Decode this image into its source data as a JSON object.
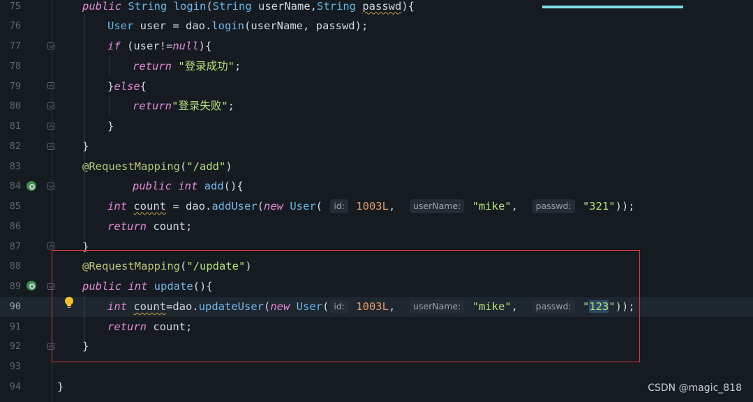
{
  "colors": {
    "background": "#161b22",
    "keyword": "#e38bd8",
    "annotation": "#b6c77a",
    "string": "#b6e07c",
    "type": "#65b8e6",
    "number": "#e79c6a",
    "redbox": "#d33b3b"
  },
  "editor": {
    "current_line": 90,
    "lines": [
      {
        "n": "75",
        "tokens": [
          {
            "t": "public ",
            "c": "kw"
          },
          {
            "t": "String ",
            "c": "type"
          },
          {
            "t": "login",
            "c": "method"
          },
          {
            "t": "(",
            "c": "plain"
          },
          {
            "t": "String ",
            "c": "type"
          },
          {
            "t": "userName",
            "c": "plain"
          },
          {
            "t": ",",
            "c": "plain"
          },
          {
            "t": "String ",
            "c": "type"
          },
          {
            "t": "passwd",
            "c": "plain",
            "u": true
          },
          {
            "t": "){",
            "c": "plain"
          }
        ]
      },
      {
        "n": "76",
        "tokens": [
          {
            "t": "User ",
            "c": "type"
          },
          {
            "t": "user = dao.",
            "c": "plain"
          },
          {
            "t": "login",
            "c": "method"
          },
          {
            "t": "(userName, passwd);",
            "c": "plain"
          }
        ]
      },
      {
        "n": "77",
        "tokens": [
          {
            "t": "if ",
            "c": "kw"
          },
          {
            "t": "(user!=",
            "c": "plain"
          },
          {
            "t": "null",
            "c": "kw"
          },
          {
            "t": "){",
            "c": "plain"
          }
        ]
      },
      {
        "n": "78",
        "tokens": [
          {
            "t": "return ",
            "c": "kw"
          },
          {
            "t": "\"登录成功\"",
            "c": "str"
          },
          {
            "t": ";",
            "c": "plain"
          }
        ]
      },
      {
        "n": "79",
        "tokens": [
          {
            "t": "}",
            "c": "plain"
          },
          {
            "t": "else",
            "c": "kw"
          },
          {
            "t": "{",
            "c": "plain"
          }
        ]
      },
      {
        "n": "80",
        "tokens": [
          {
            "t": "return",
            "c": "kw"
          },
          {
            "t": "\"登录失败\"",
            "c": "str"
          },
          {
            "t": ";",
            "c": "plain"
          }
        ]
      },
      {
        "n": "81",
        "tokens": [
          {
            "t": "}",
            "c": "plain"
          }
        ]
      },
      {
        "n": "82",
        "tokens": [
          {
            "t": "}",
            "c": "plain"
          }
        ]
      },
      {
        "n": "83",
        "tokens": [
          {
            "t": "@RequestMapping",
            "c": "ann"
          },
          {
            "t": "(",
            "c": "plain"
          },
          {
            "t": "\"/add\"",
            "c": "str"
          },
          {
            "t": ")",
            "c": "plain"
          }
        ]
      },
      {
        "n": "84",
        "tokens": [
          {
            "t": "public ",
            "c": "kw"
          },
          {
            "t": "int ",
            "c": "kw"
          },
          {
            "t": "add",
            "c": "method"
          },
          {
            "t": "(){",
            "c": "plain"
          }
        ]
      },
      {
        "n": "85",
        "tokens": [
          {
            "t": "int ",
            "c": "kw"
          },
          {
            "t": "count",
            "c": "plain",
            "u": true
          },
          {
            "t": " = dao.",
            "c": "plain"
          },
          {
            "t": "addUser",
            "c": "method"
          },
          {
            "t": "(",
            "c": "plain"
          },
          {
            "t": "new ",
            "c": "kw"
          },
          {
            "t": "User",
            "c": "type"
          },
          {
            "t": "( ",
            "c": "plain"
          },
          {
            "hint": "id:"
          },
          {
            "t": " 1003L",
            "c": "num"
          },
          {
            "t": ",  ",
            "c": "plain"
          },
          {
            "hint": "userName:"
          },
          {
            "t": " \"mike\"",
            "c": "str"
          },
          {
            "t": ",  ",
            "c": "plain"
          },
          {
            "hint": "passwd:"
          },
          {
            "t": " \"321\"",
            "c": "str"
          },
          {
            "t": "));",
            "c": "plain"
          }
        ]
      },
      {
        "n": "86",
        "tokens": [
          {
            "t": "return ",
            "c": "kw"
          },
          {
            "t": "count;",
            "c": "plain"
          }
        ]
      },
      {
        "n": "87",
        "tokens": [
          {
            "t": "}",
            "c": "plain"
          }
        ]
      },
      {
        "n": "88",
        "tokens": [
          {
            "t": "@RequestMapping",
            "c": "ann"
          },
          {
            "t": "(",
            "c": "plain"
          },
          {
            "t": "\"/update\"",
            "c": "str"
          },
          {
            "t": ")",
            "c": "plain"
          }
        ]
      },
      {
        "n": "89",
        "tokens": [
          {
            "t": "public ",
            "c": "kw"
          },
          {
            "t": "int ",
            "c": "kw"
          },
          {
            "t": "update",
            "c": "method"
          },
          {
            "t": "(){",
            "c": "plain"
          }
        ]
      },
      {
        "n": "90",
        "tokens": [
          {
            "t": "int ",
            "c": "kw"
          },
          {
            "t": "count",
            "c": "plain",
            "u": true
          },
          {
            "t": "=dao.",
            "c": "plain"
          },
          {
            "t": "updateUser",
            "c": "method"
          },
          {
            "t": "(",
            "c": "plain"
          },
          {
            "t": "new ",
            "c": "kw"
          },
          {
            "t": "User",
            "c": "type"
          },
          {
            "t": "(",
            "c": "plain"
          },
          {
            "hint": "id:"
          },
          {
            "t": " 1003L",
            "c": "num"
          },
          {
            "t": ",  ",
            "c": "plain"
          },
          {
            "hint": "userName:"
          },
          {
            "t": " \"mike\"",
            "c": "str"
          },
          {
            "t": ",  ",
            "c": "plain"
          },
          {
            "hint": "passwd:"
          },
          {
            "t": " \"",
            "c": "str"
          },
          {
            "t": "123",
            "c": "str",
            "hl": true
          },
          {
            "t": "\"",
            "c": "str"
          },
          {
            "t": "));",
            "c": "plain"
          }
        ]
      },
      {
        "n": "91",
        "tokens": [
          {
            "t": "return ",
            "c": "kw"
          },
          {
            "t": "count;",
            "c": "plain"
          }
        ]
      },
      {
        "n": "92",
        "tokens": [
          {
            "t": "}",
            "c": "plain"
          }
        ]
      },
      {
        "n": "93",
        "tokens": []
      },
      {
        "n": "94",
        "tokens": [
          {
            "t": "}",
            "c": "plain"
          }
        ]
      }
    ]
  },
  "watermark": "CSDN @magic_818"
}
